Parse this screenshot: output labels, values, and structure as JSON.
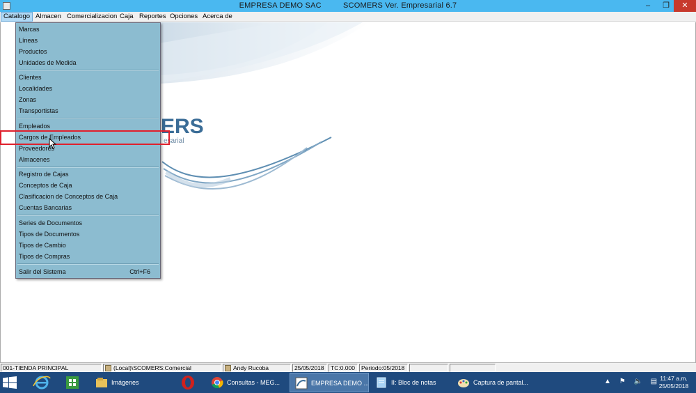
{
  "window": {
    "company": "EMPRESA DEMO SAC",
    "product": "SCOMERS Ver. Empresarial  6.7",
    "minimize": "–",
    "maximize": "❐",
    "close": "✕"
  },
  "menubar": {
    "items": [
      "Catalogo",
      "Almacen",
      "Comercializacion",
      "Caja",
      "Reportes",
      "Opciones",
      "Acerca de"
    ]
  },
  "logo": {
    "text": "ERS",
    "subtitle": "esarial"
  },
  "catalog_menu": {
    "group1": [
      "Marcas",
      "Líneas",
      "Productos",
      "Unidades de Medida"
    ],
    "group2": [
      "Clientes",
      "Localidades",
      "Zonas",
      "Transportistas"
    ],
    "group3": [
      "Empleados",
      "Cargos de Empleados",
      "Proveedores",
      "Almacenes"
    ],
    "group4": [
      "Registro de Cajas",
      "Conceptos de Caja",
      "Clasificacion de Conceptos de Caja",
      "Cuentas Bancarias"
    ],
    "group5": [
      "Series de Documentos",
      "Tipos de Documentos",
      "Tipos de Cambio",
      "Tipos de Compras"
    ],
    "exit": {
      "label": "Salir del Sistema",
      "shortcut": "Ctrl+F6"
    }
  },
  "statusbar": {
    "store": "001-TIENDA PRINCIPAL",
    "database": "(Local)\\SCOMERS:Comercial",
    "user": "Andy Rucoba",
    "date": "25/05/2018",
    "tc": "TC:0.000",
    "period": "Periodo:05/2018"
  },
  "taskbar": {
    "tasks": [
      "Imágenes",
      "Consultas - MEG...",
      "EMPRESA DEMO ...",
      "II: Bloc de notas",
      "Captura de pantal..."
    ],
    "time": "11:47 a.m.",
    "date": "25/05/2018",
    "tray_arrow": "▲"
  },
  "colors": {
    "titlebar": "#4ab8f0",
    "menu_bg": "#8cbcd0",
    "highlight": "#e0202c",
    "taskbar": "#1f4a7e",
    "logo": "#3b6d97"
  }
}
